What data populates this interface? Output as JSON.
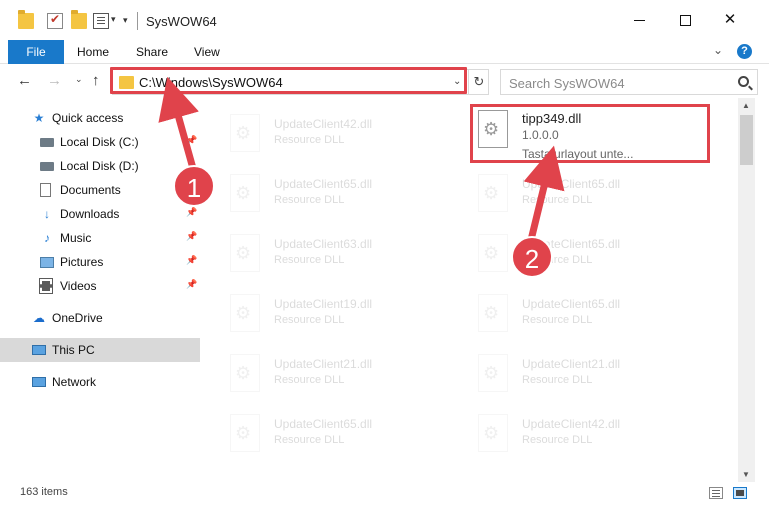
{
  "window": {
    "title": "SysWOW64",
    "minimize_icon": "minimize-icon",
    "maximize_icon": "maximize-icon",
    "close_label": "✕"
  },
  "ribbon": {
    "tabs": [
      "File",
      "Home",
      "Share",
      "View"
    ],
    "help_label": "?"
  },
  "address": {
    "path": "C:\\Windows\\SysWOW64",
    "search_placeholder": "Search SysWOW64",
    "refresh_icon": "↻"
  },
  "nav": {
    "items": [
      {
        "label": "Quick access",
        "icon": "star-icon",
        "pinned": false
      },
      {
        "label": "Local Disk (C:)",
        "icon": "drive-icon",
        "pinned": true
      },
      {
        "label": "Local Disk (D:)",
        "icon": "drive-icon",
        "pinned": false
      },
      {
        "label": "Documents",
        "icon": "document-icon",
        "pinned": true
      },
      {
        "label": "Downloads",
        "icon": "download-icon",
        "pinned": true
      },
      {
        "label": "Music",
        "icon": "music-icon",
        "pinned": true
      },
      {
        "label": "Pictures",
        "icon": "pictures-icon",
        "pinned": true
      },
      {
        "label": "Videos",
        "icon": "videos-icon",
        "pinned": true
      },
      {
        "label": "OneDrive",
        "icon": "cloud-icon",
        "pinned": false
      },
      {
        "label": "This PC",
        "icon": "pc-icon",
        "pinned": false
      },
      {
        "label": "Network",
        "icon": "network-icon",
        "pinned": false
      }
    ]
  },
  "files": {
    "left_column": [
      {
        "name": "UpdateClient42.dll",
        "type": "Resource DLL"
      },
      {
        "name": "UpdateClient65.dll",
        "type": "Resource DLL"
      },
      {
        "name": "UpdateClient63.dll",
        "type": "Resource DLL"
      },
      {
        "name": "UpdateClient19.dll",
        "type": "Resource DLL"
      },
      {
        "name": "UpdateClient21.dll",
        "type": "Resource DLL"
      },
      {
        "name": "UpdateClient65.dll",
        "type": "Resource DLL"
      }
    ],
    "featured": {
      "name": "tipp349.dll",
      "version": "1.0.0.0",
      "description": "Tastaturlayout unte..."
    },
    "right_column": [
      {
        "name": "UpdateClient65.dll",
        "type": "Resource DLL"
      },
      {
        "name": "UpdateClient65.dll",
        "type": "Resource DLL"
      },
      {
        "name": "UpdateClient65.dll",
        "type": "Resource DLL"
      },
      {
        "name": "UpdateClient21.dll",
        "type": "Resource DLL"
      },
      {
        "name": "UpdateClient42.dll",
        "type": "Resource DLL"
      }
    ]
  },
  "status": {
    "item_count": "163 items"
  },
  "annotations": {
    "step1": "1",
    "step2": "2",
    "color": "#e0434b"
  },
  "colors": {
    "accent": "#1979ca",
    "highlight": "#e0434b",
    "selection": "#d9d9d9"
  }
}
